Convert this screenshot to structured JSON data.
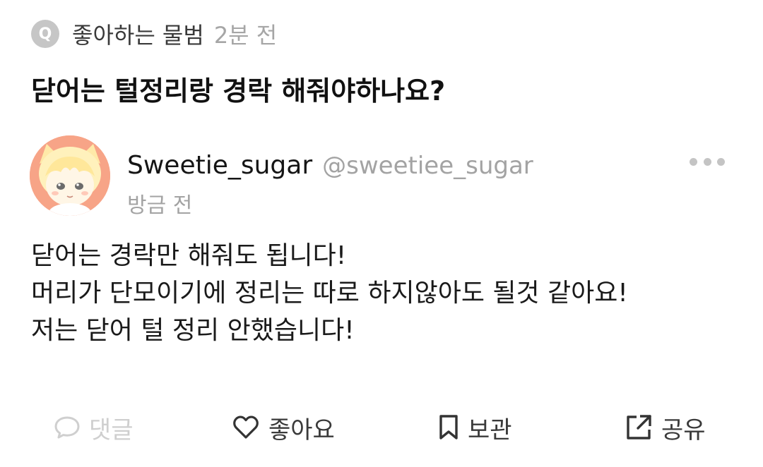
{
  "question": {
    "badge": "Q",
    "author": "좋아하는 물범",
    "time": "2분 전",
    "title": "닫어는 털정리랑 경락 해줘야하나요?"
  },
  "answer": {
    "nickname": "Sweetie_sugar",
    "handle": "@sweetiee_sugar",
    "time": "방금 전",
    "body_lines": [
      "닫어는 경락만 해줘도 됩니다!",
      "머리가 단모이기에 정리는 따로 하지않아도 될것 같아요!",
      "저는 닫어 털 정리 안했습니다!"
    ]
  },
  "actions": {
    "comment": "댓글",
    "like": "좋아요",
    "bookmark": "보관",
    "share": "공유"
  },
  "icons": {
    "comment": "speech-bubble-icon",
    "like": "heart-icon",
    "bookmark": "bookmark-icon",
    "share": "share-icon",
    "more": "more-dots-icon"
  },
  "colors": {
    "disabled": "#cfcfcf",
    "secondary": "#a3a3a3",
    "avatar_bg": "#f7a487"
  }
}
